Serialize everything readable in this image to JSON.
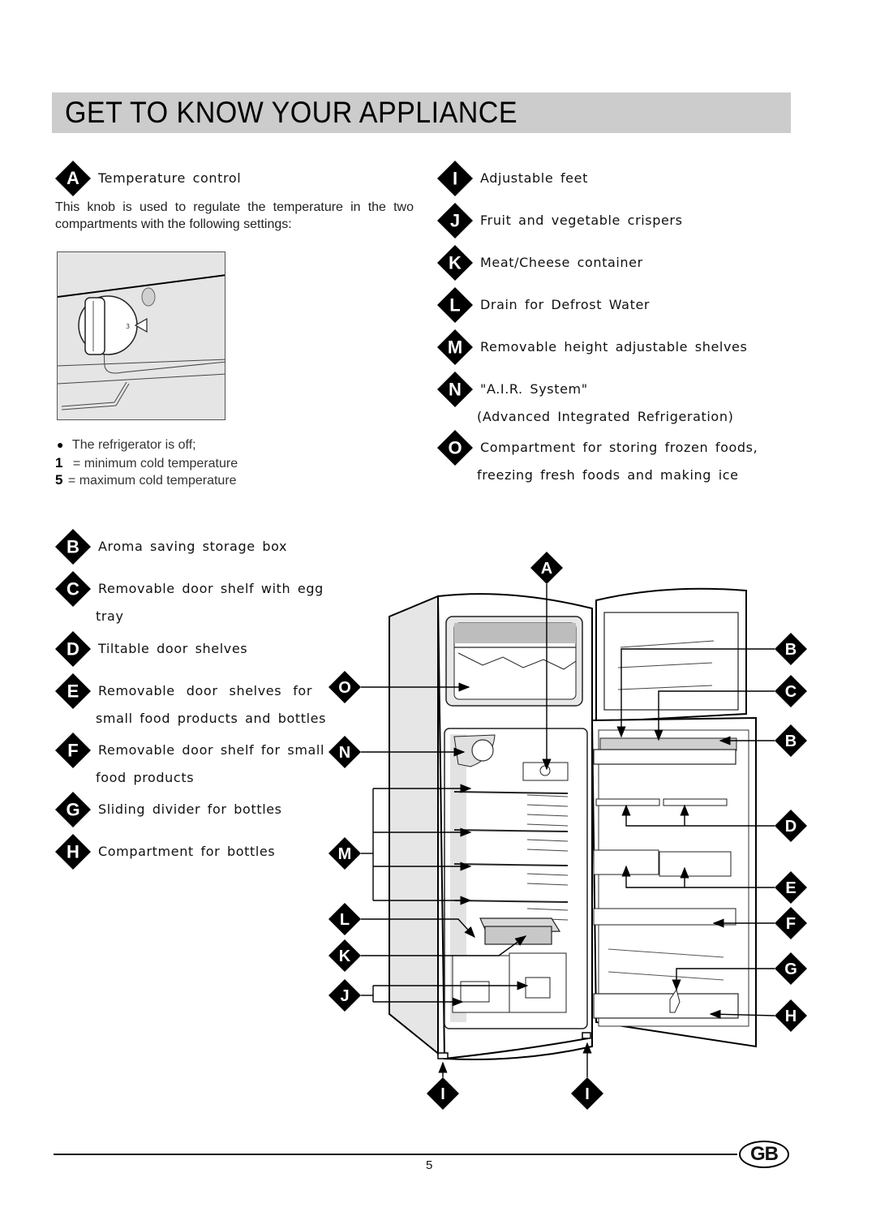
{
  "page": {
    "title": "GET TO KNOW YOUR APPLIANCE",
    "page_number": "5",
    "language_badge": "GB"
  },
  "section_a": {
    "letter": "A",
    "label": "Temperature control",
    "description_line1": "This knob is used to regulate the temperature in the two",
    "description_line2": "compartments with the following settings:",
    "settings": [
      {
        "key": "●",
        "text": "The refrigerator is off;"
      },
      {
        "key": "1",
        "text": "= minimum cold temperature"
      },
      {
        "key": "5",
        "text": "= maximum cold temperature"
      }
    ]
  },
  "right_items": [
    {
      "letter": "I",
      "label": "Adjustable feet"
    },
    {
      "letter": "J",
      "label": "Fruit and vegetable crispers"
    },
    {
      "letter": "K",
      "label": "Meat/Cheese container"
    },
    {
      "letter": "L",
      "label": "Drain for Defrost Water"
    },
    {
      "letter": "M",
      "label": "Removable height adjustable shelves"
    },
    {
      "letter": "N",
      "label": "\"A.I.R. System\"",
      "label2": "(Advanced Integrated Refrigeration)"
    },
    {
      "letter": "O",
      "label": "Compartment for storing frozen foods,",
      "label2": "freezing fresh foods and making ice"
    }
  ],
  "left_items": [
    {
      "letter": "B",
      "label": "Aroma saving storage box"
    },
    {
      "letter": "C",
      "label": "Removable door shelf with egg",
      "label2": "tray"
    },
    {
      "letter": "D",
      "label": "Tiltable door shelves"
    },
    {
      "letter": "E",
      "label": "Removable door shelves for",
      "label2": "small food products and bottles"
    },
    {
      "letter": "F",
      "label": "Removable door shelf for small",
      "label2": "food products"
    },
    {
      "letter": "G",
      "label": "Sliding divider for bottles"
    },
    {
      "letter": "H",
      "label": "Compartment for bottles"
    }
  ],
  "diagram_callouts": {
    "top": "A",
    "left": [
      "O",
      "N",
      "M",
      "L",
      "K",
      "J"
    ],
    "right": [
      "B",
      "C",
      "B",
      "D",
      "E",
      "F",
      "G",
      "H"
    ],
    "bottom": [
      "I",
      "I"
    ]
  },
  "knob_marker": "3"
}
